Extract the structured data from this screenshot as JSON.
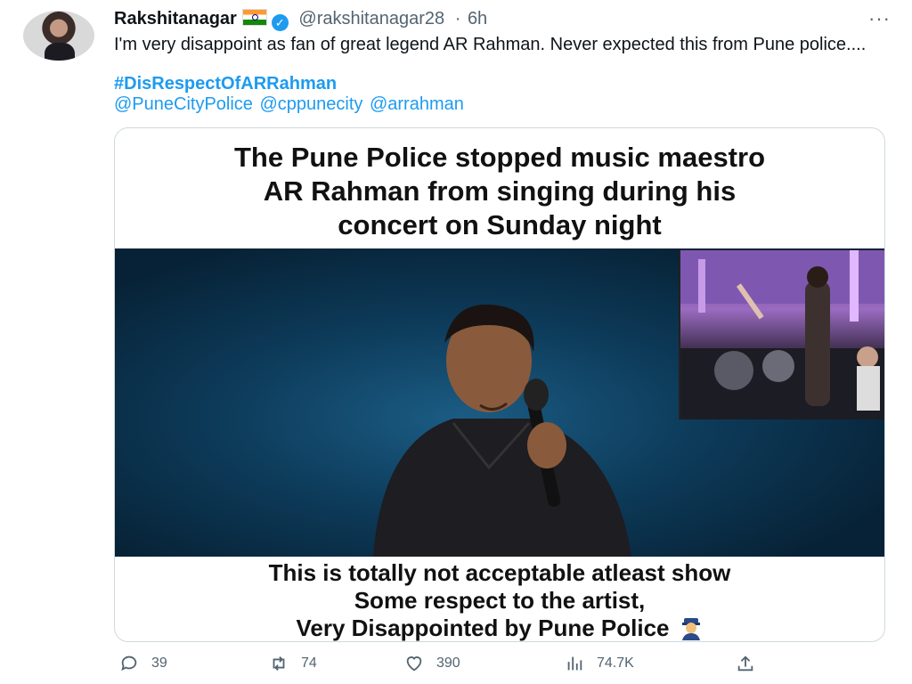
{
  "tweet": {
    "display_name": "Rakshitanagar",
    "handle": "@rakshitanagar28",
    "separator": "·",
    "time": "6h",
    "more_label": "···",
    "text": "I'm very disappoint as fan of great legend AR Rahman. Never expected this from Pune police....",
    "hashtag": "#DisRespectOfARRahman",
    "mentions": "@PuneCityPolice @cppunecity @arrahman",
    "verified_icon": "verified-badge-icon",
    "flag_icon": "india-flag-icon"
  },
  "card": {
    "headline_line1": "The Pune Police stopped music maestro",
    "headline_line2": "AR Rahman from singing during his",
    "headline_line3": "concert on Sunday night",
    "caption_line1": "This is totally not acceptable atleast show",
    "caption_line2": "Some respect to the artist,",
    "caption_line3": "Very Disappointed by Pune Police"
  },
  "actions": {
    "replies": "39",
    "retweets": "74",
    "likes": "390",
    "views": "74.7K"
  },
  "colors": {
    "accent": "#1d9bf0",
    "text": "#0f1419",
    "muted": "#536471"
  }
}
